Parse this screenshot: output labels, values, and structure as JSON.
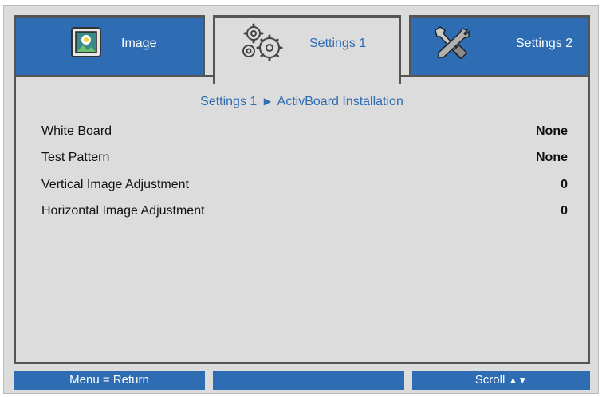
{
  "tabs": [
    {
      "label": "Image",
      "icon": "image-icon",
      "active": false
    },
    {
      "label": "Settings 1",
      "icon": "gears-icon",
      "active": true
    },
    {
      "label": "Settings 2",
      "icon": "tools-icon",
      "active": false
    }
  ],
  "breadcrumb": {
    "parent": "Settings 1",
    "separator_icon": "triangle-right-icon",
    "current": "ActivBoard Installation"
  },
  "menu": {
    "items": [
      {
        "label": "White Board",
        "value": "None"
      },
      {
        "label": "Test Pattern",
        "value": "None"
      },
      {
        "label": "Vertical Image Adjustment",
        "value": "0"
      },
      {
        "label": "Horizontal Image Adjustment",
        "value": "0"
      }
    ]
  },
  "status_bar": {
    "left": "Menu = Return",
    "middle": "",
    "right": "Scroll",
    "right_icons": [
      "triangle-up-icon",
      "triangle-down-icon"
    ]
  },
  "colors": {
    "accent_blue": "#2e6cb4",
    "panel_gray": "#dcdcdc",
    "border_dark": "#555555"
  }
}
